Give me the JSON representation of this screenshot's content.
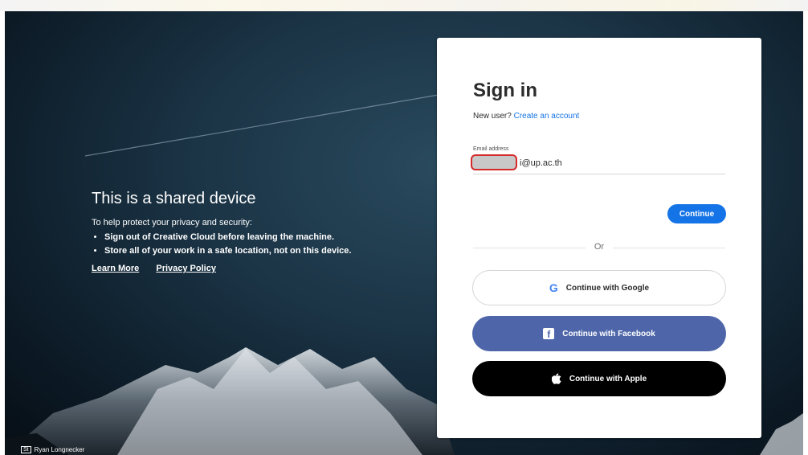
{
  "background": {
    "shared_title": "This is a shared device",
    "shared_subtitle": "To help protect your privacy and security:",
    "bullets": [
      "Sign out of Creative Cloud before leaving the machine.",
      "Store all of your work in a safe location, not on this device."
    ],
    "links": {
      "learn_more": "Learn More",
      "privacy_policy": "Privacy Policy"
    },
    "credit_badge": "St",
    "credit_name": "Ryan Longnecker"
  },
  "signin": {
    "title": "Sign in",
    "new_user_text": "New user?",
    "create_account_link": "Create an account",
    "email_label": "Email address",
    "email_value": "i@up.ac.th",
    "continue_label": "Continue",
    "or_text": "Or",
    "google_label": "Continue with Google",
    "facebook_label": "Continue with Facebook",
    "apple_label": "Continue with Apple"
  },
  "icons": {
    "google": "google-icon",
    "facebook": "facebook-icon",
    "apple": "apple-icon"
  },
  "colors": {
    "accent": "#1473e6",
    "facebook": "#4e66a9",
    "apple": "#000000",
    "redact_outline": "#d42a2a"
  }
}
